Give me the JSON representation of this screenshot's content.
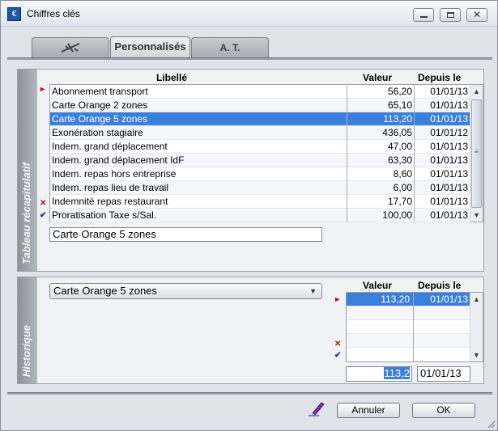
{
  "window": {
    "title": "Chiffres clés",
    "icon": "app-euro-icon",
    "close_glyph": "✕"
  },
  "tabs": [
    {
      "label": "",
      "icon": "airplane-icon",
      "active": false
    },
    {
      "label": "Personnalisés",
      "active": true
    },
    {
      "label": "A. T.",
      "active": false
    }
  ],
  "summary": {
    "side_label": "Tableau récapitulatif",
    "columns": {
      "libelle": "Libellé",
      "valeur": "Valeur",
      "depuis": "Depuis le"
    },
    "rows": [
      {
        "libelle": "Abonnement transport",
        "valeur": "56,20",
        "depuis": "01/01/13"
      },
      {
        "libelle": "Carte Orange 2 zones",
        "valeur": "65,10",
        "depuis": "01/01/13"
      },
      {
        "libelle": "Carte Orange 5 zones",
        "valeur": "113,20",
        "depuis": "01/01/13",
        "selected": true
      },
      {
        "libelle": "Exonération stagiaire",
        "valeur": "436,05",
        "depuis": "01/01/12"
      },
      {
        "libelle": "Indem. grand déplacement",
        "valeur": "47,00",
        "depuis": "01/01/13"
      },
      {
        "libelle": "Indem. grand déplacement IdF",
        "valeur": "63,30",
        "depuis": "01/01/13"
      },
      {
        "libelle": "Indem. repas hors entreprise",
        "valeur": "8,60",
        "depuis": "01/01/13"
      },
      {
        "libelle": "Indem. repas lieu de travail",
        "valeur": "6,00",
        "depuis": "01/01/13"
      },
      {
        "libelle": "Indemnité repas restaurant",
        "valeur": "17,70",
        "depuis": "01/01/13"
      },
      {
        "libelle": "Proratisation Taxe s/Sal.",
        "valeur": "100,00",
        "depuis": "01/01/13"
      }
    ],
    "edit_value": "Carte Orange 5 zones"
  },
  "history": {
    "side_label": "Historique",
    "selected": "Carte Orange 5 zones",
    "columns": {
      "valeur": "Valeur",
      "depuis": "Depuis le"
    },
    "rows": [
      {
        "valeur": "113,20",
        "depuis": "01/01/13",
        "selected": true
      }
    ],
    "edit_valeur": "113,2",
    "edit_depuis": "01/01/13"
  },
  "buttons": {
    "cancel": "Annuler",
    "ok": "OK"
  },
  "colors": {
    "selection": "#3b7fdc",
    "delete_marker": "#b0141c",
    "validate_marker": "#1d2f8f",
    "insert_marker": "#b0141c"
  }
}
